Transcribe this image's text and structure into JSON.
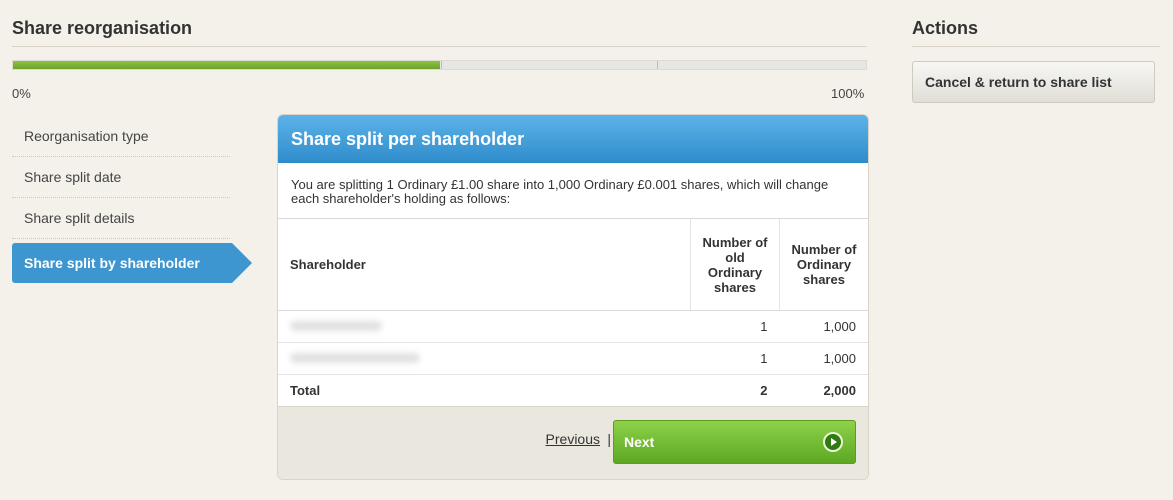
{
  "title": "Share reorganisation",
  "progress": {
    "value_percent": 50,
    "start_label": "0%",
    "end_label": "100%",
    "fill_color": "#7cb82f"
  },
  "steps": [
    {
      "label": "Reorganisation type"
    },
    {
      "label": "Share split date"
    },
    {
      "label": "Share split details"
    },
    {
      "label": "Share split by shareholder",
      "active": true
    }
  ],
  "panel": {
    "title": "Share split per shareholder",
    "intro": "You are splitting 1 Ordinary £1.00 share into 1,000 Ordinary £0.001 shares, which will change each shareholder's holding as follows:",
    "columns": [
      "Shareholder",
      "Number of old Ordinary shares",
      "Number of Ordinary shares"
    ],
    "rows": [
      {
        "old": "1",
        "new": "1,000"
      },
      {
        "old": "1",
        "new": "1,000"
      }
    ],
    "total": {
      "label": "Total",
      "old": "2",
      "new": "2,000"
    }
  },
  "footer": {
    "previous_label": "Previous",
    "separator": "|",
    "next_label": "Next"
  },
  "actions": {
    "title": "Actions",
    "cancel_label": "Cancel & return to share list"
  },
  "colors": {
    "accent_blue": "#3d96cf",
    "next_green": "#6aba2f",
    "background": "#f4f1ea"
  }
}
